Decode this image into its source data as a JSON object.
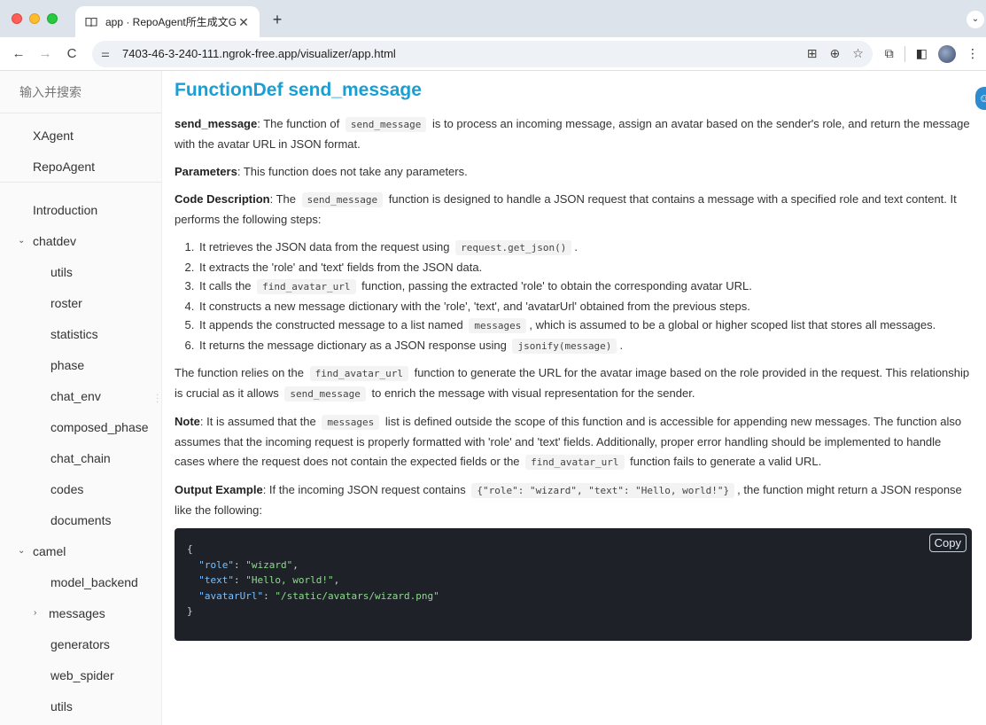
{
  "browser": {
    "tab_title": "app · RepoAgent所生成文GitB",
    "new_tab_symbol": "+",
    "url": "7403-46-3-240-111.ngrok-free.app/visualizer/app.html"
  },
  "sidebar": {
    "search_placeholder": "输入并搜索",
    "top_items": [
      "XAgent",
      "RepoAgent"
    ],
    "intro": "Introduction",
    "chatdev": "chatdev",
    "chatdev_children": [
      "utils",
      "roster",
      "statistics",
      "phase",
      "chat_env",
      "composed_phase",
      "chat_chain",
      "codes",
      "documents"
    ],
    "camel": "camel",
    "camel_children": [
      "model_backend",
      "messages",
      "generators",
      "web_spider",
      "utils"
    ]
  },
  "doc": {
    "title": "FunctionDef send_message",
    "summary_label": "send_message",
    "summary_1": ": The function of",
    "summary_code": "send_message",
    "summary_2": "is to process an incoming message, assign an avatar based on the sender's role, and return the message with the avatar URL in JSON format.",
    "params_label": "Parameters",
    "params_text": ": This function does not take any parameters.",
    "desc_label": "Code Description",
    "desc_1": ": The",
    "desc_code": "send_message",
    "desc_2": "function is designed to handle a JSON request that contains a message with a specified role and text content. It performs the following steps:",
    "steps": {
      "s1_a": "It retrieves the JSON data from the request using",
      "s1_code": "request.get_json()",
      "s1_b": ".",
      "s2": "It extracts the 'role' and 'text' fields from the JSON data.",
      "s3_a": "It calls the",
      "s3_code": "find_avatar_url",
      "s3_b": "function, passing the extracted 'role' to obtain the corresponding avatar URL.",
      "s4": "It constructs a new message dictionary with the 'role', 'text', and 'avatarUrl' obtained from the previous steps.",
      "s5_a": "It appends the constructed message to a list named",
      "s5_code": "messages",
      "s5_b": ", which is assumed to be a global or higher scoped list that stores all messages.",
      "s6_a": "It returns the message dictionary as a JSON response using",
      "s6_code": "jsonify(message)",
      "s6_b": "."
    },
    "relies_1": "The function relies on the",
    "relies_code1": "find_avatar_url",
    "relies_2": "function to generate the URL for the avatar image based on the role provided in the request. This relationship is crucial as it allows",
    "relies_code2": "send_message",
    "relies_3": "to enrich the message with visual representation for the sender.",
    "note_label": "Note",
    "note_1": ": It is assumed that the",
    "note_code1": "messages",
    "note_2": "list is defined outside the scope of this function and is accessible for appending new messages. The function also assumes that the incoming request is properly formatted with 'role' and 'text' fields. Additionally, proper error handling should be implemented to handle cases where the request does not contain the expected fields or the",
    "note_code2": "find_avatar_url",
    "note_3": "function fails to generate a valid URL.",
    "output_label": "Output Example",
    "output_1": ": If the incoming JSON request contains",
    "output_code": "{\"role\": \"wizard\", \"text\": \"Hello, world!\"}",
    "output_2": ", the function might return a JSON response like the following:",
    "copy_label": "Copy",
    "code": {
      "open": "{",
      "k1": "\"role\"",
      "v1": "\"wizard\"",
      "k2": "\"text\"",
      "v2": "\"Hello, world!\"",
      "k3": "\"avatarUrl\"",
      "v3": "\"/static/avatars/wizard.png\"",
      "close": "}"
    }
  }
}
